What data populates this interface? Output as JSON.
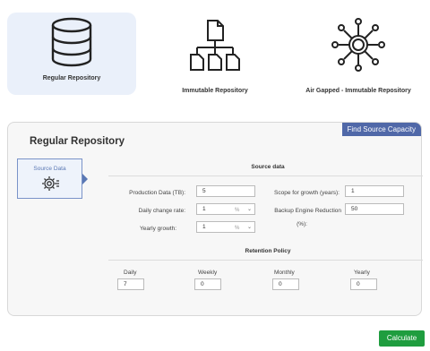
{
  "repositories": [
    {
      "label": "Regular Repository",
      "icon": "database-icon",
      "selected": true
    },
    {
      "label": "Immutable Repository",
      "icon": "hierarchy-files-icon",
      "selected": false
    },
    {
      "label": "Air Gapped - Immutable Repository",
      "icon": "network-hub-icon",
      "selected": false
    }
  ],
  "panel": {
    "title": "Regular Repository",
    "find_button": "Find Source Capacity",
    "tab_label": "Source Data",
    "tab_icon": "gear-cog-icon"
  },
  "source_data": {
    "title": "Source data",
    "production_label": "Production Data (TB):",
    "production_value": "5",
    "daily_change_label": "Daily change rate:",
    "daily_change_value": "1",
    "daily_change_unit": "%",
    "yearly_growth_label": "Yearly growth:",
    "yearly_growth_value": "1",
    "yearly_growth_unit": "%",
    "scope_label": "Scope for growth (years):",
    "scope_value": "1",
    "reduction_label_1": "Backup Engine Reduction",
    "reduction_label_2": "(%):",
    "reduction_value": "50"
  },
  "retention": {
    "title": "Retention Policy",
    "daily_label": "Daily",
    "daily_value": "7",
    "weekly_label": "Weekly",
    "weekly_value": "0",
    "monthly_label": "Monthly",
    "monthly_value": "0",
    "yearly_label": "Yearly",
    "yearly_value": "0"
  },
  "calculate_button": "Calculate",
  "colors": {
    "accent": "#5068a8",
    "selected_card": "#eaf0fa",
    "calculate": "#1f9d3f"
  }
}
